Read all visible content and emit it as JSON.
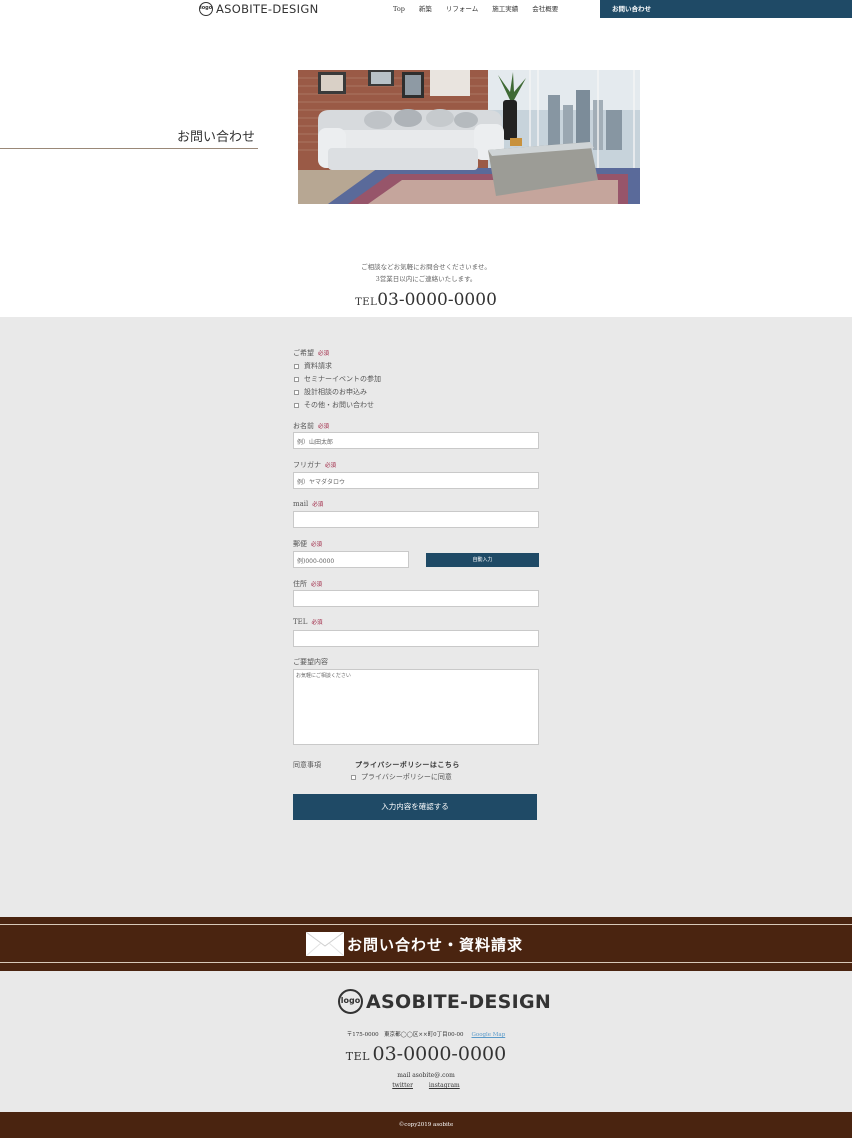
{
  "header": {
    "logo_badge": "logo",
    "logo_text": "ASOBITE-DESIGN",
    "nav": [
      "Top",
      "新築",
      "リフォーム",
      "施工実績",
      "会社概要",
      "お問い合わせ"
    ]
  },
  "hero": {
    "title": "お問い合わせ",
    "image_alt": "living room with white sofa"
  },
  "intro": {
    "line1": "ご相談などお気軽にお問合せくださいませ。",
    "line2": "3営業日以内にご連絡いたします。",
    "tel_label": "TEL",
    "tel_number": "03-0000-0000"
  },
  "form": {
    "required": "必須",
    "request_label": "ご希望",
    "options": [
      "資料請求",
      "セミナーイベントの参加",
      "設計相談のお申込み",
      "その他・お問い合わせ"
    ],
    "name_label": "お名前",
    "name_placeholder": "例）山田太郎",
    "kana_label": "フリガナ",
    "kana_placeholder": "例）ヤマダタロウ",
    "mail_label": "mail",
    "mail_placeholder": "",
    "postal_label": "郵便",
    "postal_placeholder": "例)000-0000",
    "autofill_button": "自動入力",
    "address_label": "住所",
    "address_placeholder": "",
    "tel_label": "TEL",
    "tel_placeholder": "",
    "message_label": "ご要望内容",
    "message_placeholder": "お気軽にご相談ください",
    "agree_label": "同意事項",
    "privacy_link": "プライバシーポリシーはこちら",
    "privacy_check": "プライバシーポリシーに同意",
    "confirm_button": "入力内容を確認する"
  },
  "contact_banner": {
    "text": "お問い合わせ・資料請求"
  },
  "footer": {
    "logo_badge": "logo",
    "logo_text": "ASOBITE-DESIGN",
    "address": "〒175-0000　東京都◯◯区××町0丁目00-00",
    "map_link": "Google Map",
    "tel_label": "TEL",
    "tel_number": "03-0000-0000",
    "mail": "mail asobite@.com",
    "links": [
      "twitter",
      "instagram"
    ],
    "copyright": "©copy2019 asobite"
  },
  "colors": {
    "accent": "#1f4a66",
    "brown": "#4a2410",
    "form_bg": "#e9e9e9",
    "required": "#9c1c3c"
  }
}
